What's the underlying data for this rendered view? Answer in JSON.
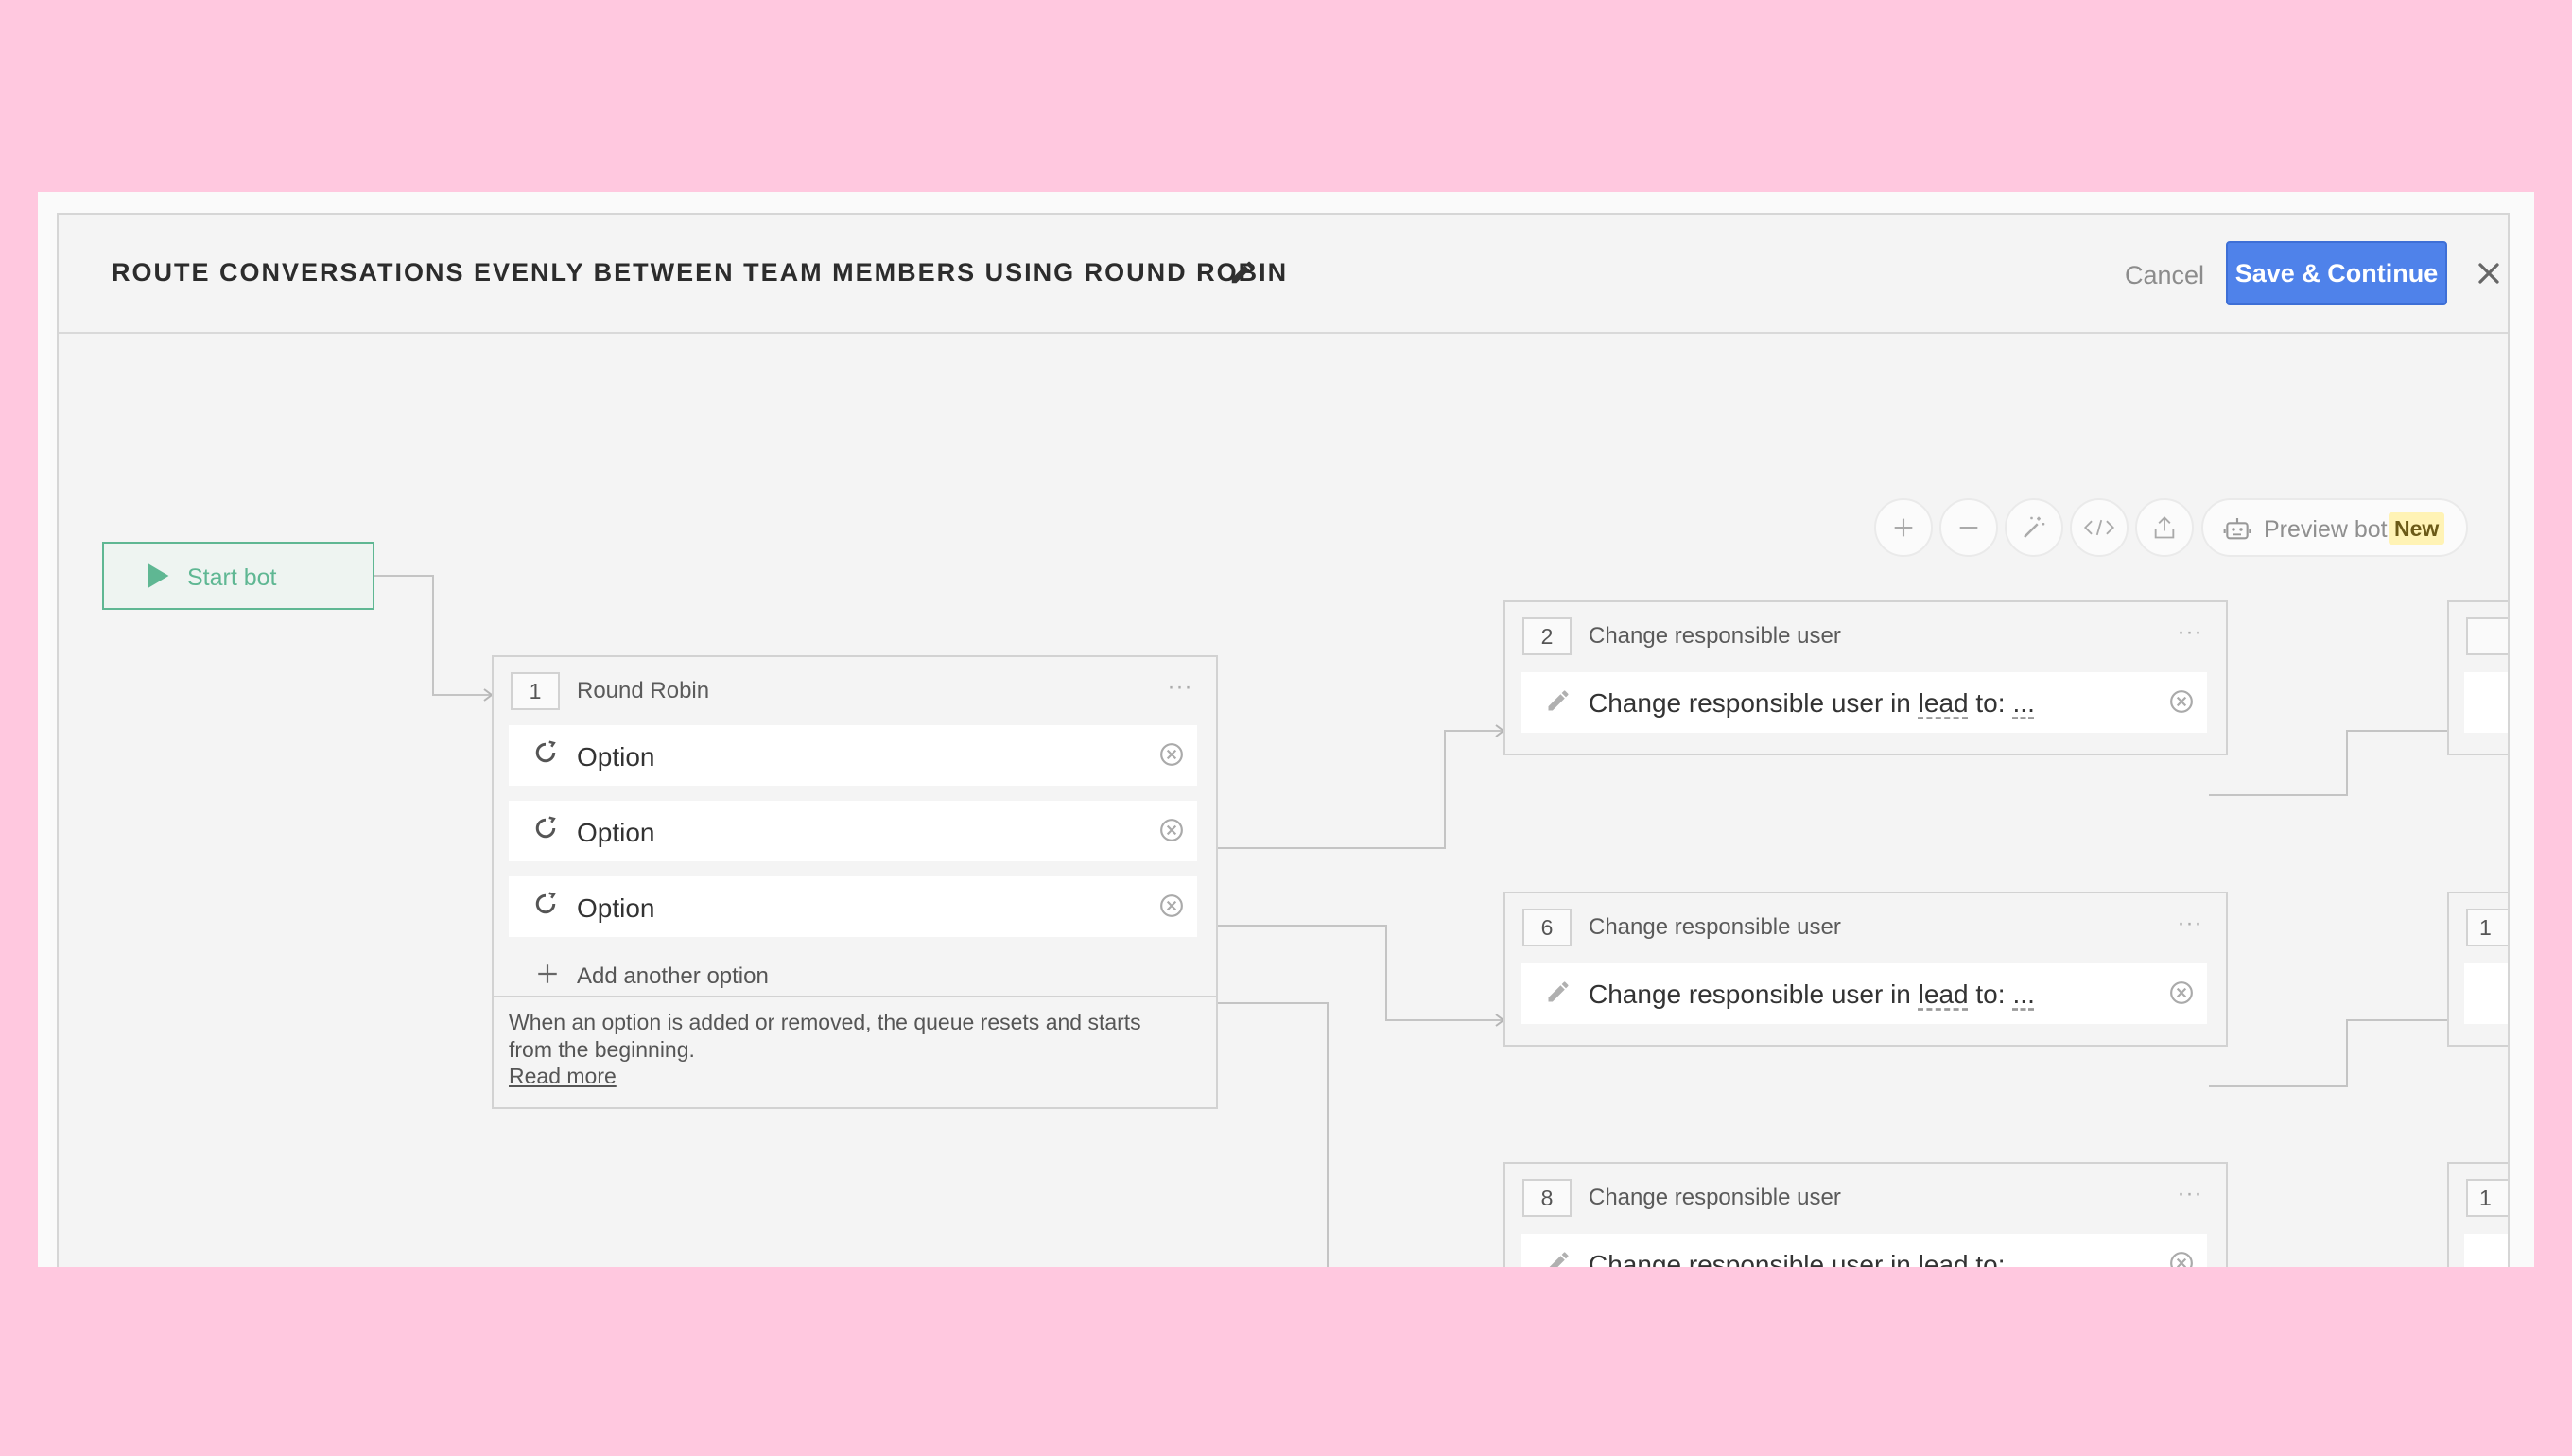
{
  "modal": {
    "title": "ROUTE CONVERSATIONS EVENLY BETWEEN TEAM MEMBERS USING ROUND ROBIN",
    "cancel_label": "Cancel",
    "save_label": "Save & Continue"
  },
  "toolbar": {
    "buttons": [
      "zoom-in-icon",
      "zoom-out-icon",
      "magic-wand-icon",
      "code-icon",
      "export-icon"
    ],
    "preview_label": "Preview bot",
    "preview_badge": "New"
  },
  "start": {
    "label": "Start bot"
  },
  "round_robin": {
    "number": "1",
    "title": "Round Robin",
    "menu": "···",
    "options": [
      {
        "label": "Option"
      },
      {
        "label": "Option"
      },
      {
        "label": "Option"
      }
    ],
    "add_label": "Add another option",
    "note": "When an option is added or removed, the queue resets and starts from the beginning.",
    "read_more": "Read more"
  },
  "actions": [
    {
      "number": "2",
      "title": "Change responsible user",
      "menu": "···",
      "text": "Change responsible user in",
      "entity": "lead",
      "suffix": "to:",
      "value": "..."
    },
    {
      "number": "6",
      "title": "Change responsible user",
      "menu": "···",
      "text": "Change responsible user in",
      "entity": "lead",
      "suffix": "to:",
      "value": "..."
    },
    {
      "number": "8",
      "title": "Change responsible user",
      "menu": "···",
      "text": "Change responsible user in",
      "entity": "lead",
      "suffix": "to:",
      "value": "..."
    }
  ],
  "offscreen_nodes": [
    {
      "number": ""
    },
    {
      "number": "1"
    },
    {
      "number": "1"
    }
  ],
  "colors": {
    "background": "#ffc8df",
    "accent": "#4f82ea",
    "start_green": "#5fb793",
    "badge_bg": "#fff3b5"
  }
}
